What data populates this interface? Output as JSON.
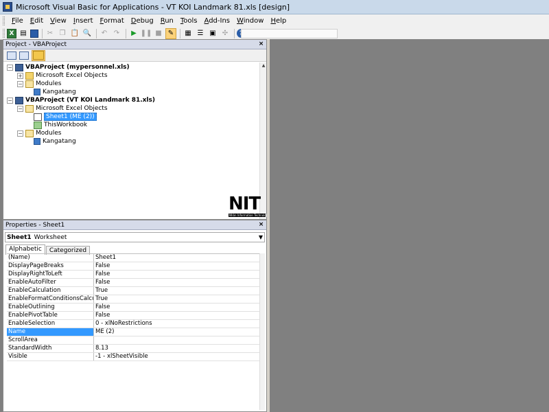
{
  "window": {
    "title": "Microsoft Visual Basic for Applications - VT KOI Landmark 81.xls [design]"
  },
  "menu": {
    "items": [
      {
        "id": "file",
        "label": "File"
      },
      {
        "id": "edit",
        "label": "Edit"
      },
      {
        "id": "view",
        "label": "View"
      },
      {
        "id": "insert",
        "label": "Insert"
      },
      {
        "id": "format",
        "label": "Format"
      },
      {
        "id": "debug",
        "label": "Debug"
      },
      {
        "id": "run",
        "label": "Run"
      },
      {
        "id": "tools",
        "label": "Tools"
      },
      {
        "id": "addins",
        "label": "Add-Ins"
      },
      {
        "id": "window",
        "label": "Window"
      },
      {
        "id": "help",
        "label": "Help"
      }
    ]
  },
  "toolbar": {
    "icons": {
      "excel": "X",
      "insert": "▤",
      "cut": "✂",
      "copy": "❐",
      "paste": "📋",
      "find": "🔍",
      "undo": "↶",
      "redo": "↷",
      "run": "▶",
      "break": "❚❚",
      "reset": "■",
      "design": "✎",
      "project": "▦",
      "properties": "☰",
      "object": "▣",
      "toolbox": "✣",
      "help": "?"
    }
  },
  "project_pane": {
    "title": "Project - VBAProject",
    "close": "×",
    "tree": [
      {
        "id": "p1",
        "level": 0,
        "label": "VBAProject (mypersonnel.xls)",
        "icon": "project-icon",
        "exp": "−",
        "bold": true
      },
      {
        "id": "p1_objects",
        "level": 1,
        "label": "Microsoft Excel Objects",
        "icon": "folder-icon",
        "exp": "+"
      },
      {
        "id": "p1_modules",
        "level": 1,
        "label": "Modules",
        "icon": "folder-open-icon",
        "exp": "−"
      },
      {
        "id": "p1_mod_kangatang",
        "level": 2,
        "label": "Kangatang",
        "icon": "module-icon",
        "exp": ""
      },
      {
        "id": "p2",
        "level": 0,
        "label": "VBAProject (VT KOI Landmark 81.xls)",
        "icon": "project-icon",
        "exp": "−",
        "bold": true
      },
      {
        "id": "p2_objects",
        "level": 1,
        "label": "Microsoft Excel Objects",
        "icon": "folder-open-icon",
        "exp": "−"
      },
      {
        "id": "p2_sheet1",
        "level": 2,
        "label": "Sheet1 (ME  (2))",
        "icon": "sheet-icon",
        "exp": "",
        "selected": true
      },
      {
        "id": "p2_thisworkbook",
        "level": 2,
        "label": "ThisWorkbook",
        "icon": "workbook-icon",
        "exp": ""
      },
      {
        "id": "p2_modules",
        "level": 1,
        "label": "Modules",
        "icon": "folder-open-icon",
        "exp": "−"
      },
      {
        "id": "p2_mod_kangatang",
        "level": 2,
        "label": "Kangatang",
        "icon": "module-icon",
        "exp": ""
      }
    ],
    "logo": {
      "big": "NIT",
      "small": "Nhân Information Technology"
    }
  },
  "properties_pane": {
    "title": "Properties - Sheet1",
    "close": "×",
    "object_name": "Sheet1",
    "object_type": "Worksheet",
    "tabs": [
      "Alphabetic",
      "Categorized"
    ],
    "rows": [
      {
        "name": "(Name)",
        "value": "Sheet1"
      },
      {
        "name": "DisplayPageBreaks",
        "value": "False"
      },
      {
        "name": "DisplayRightToLeft",
        "value": "False"
      },
      {
        "name": "EnableAutoFilter",
        "value": "False"
      },
      {
        "name": "EnableCalculation",
        "value": "True"
      },
      {
        "name": "EnableFormatConditionsCalculation",
        "value": "True"
      },
      {
        "name": "EnableOutlining",
        "value": "False"
      },
      {
        "name": "EnablePivotTable",
        "value": "False"
      },
      {
        "name": "EnableSelection",
        "value": "0 - xlNoRestrictions"
      },
      {
        "name": "Name",
        "value": "ME  (2)",
        "selected": true
      },
      {
        "name": "ScrollArea",
        "value": ""
      },
      {
        "name": "StandardWidth",
        "value": "8.13"
      },
      {
        "name": "Visible",
        "value": "-1 - xlSheetVisible"
      }
    ]
  }
}
